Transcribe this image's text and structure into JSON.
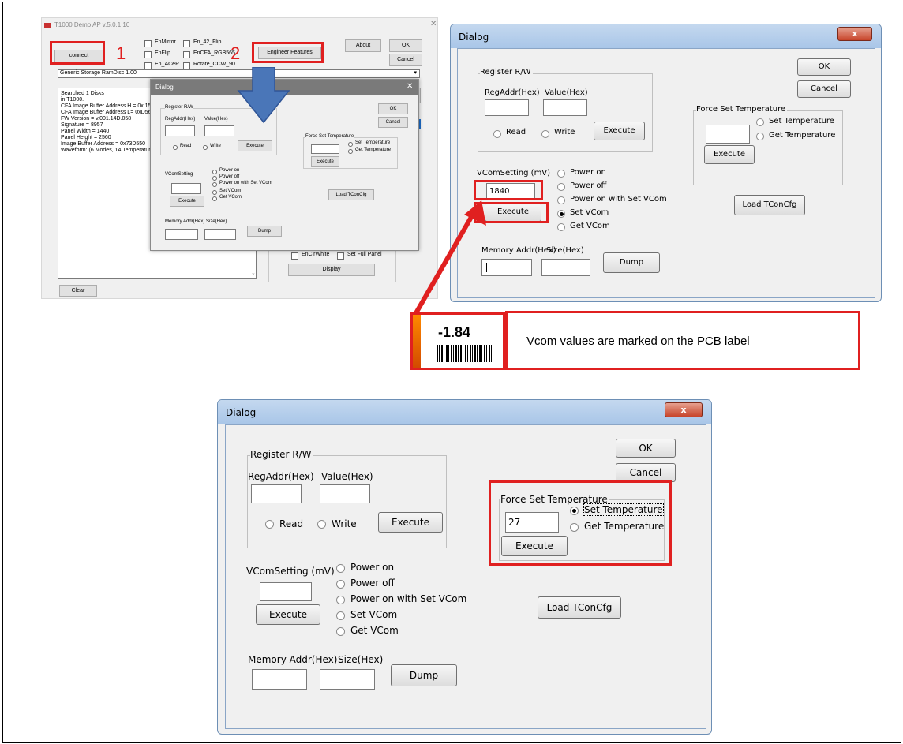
{
  "app": {
    "title": "T1000 Demo AP v.5.0.1.10",
    "connect": "connect",
    "checks": [
      "EnMirror",
      "En_42_Flip",
      "EnFlip",
      "EnCFA_RGB565",
      "En_ACeP",
      "Rotate_CCW_90"
    ],
    "engineer_features": "Engineer Features",
    "about": "About",
    "ok": "OK",
    "cancel": "Cancel",
    "disk_select": "Generic Storage RamDisc 1.00",
    "log_lines": [
      "Searched 1 Disks",
      "in T1000.",
      "CFA Image Buffer Address H = 0x 154",
      "CFA Image Buffer Address L= 0xD568",
      "FW Version = v.001.14D.058",
      "Signature = 8957",
      "Panel Width = 1440",
      "Panel Height = 2560",
      "Image Buffer Address = 0x73D550",
      "Waveform: (6 Modes, 14 Temperature"
    ],
    "clear": "Clear",
    "en_clr_white": "EnClrWhite",
    "set_full_panel": "Set Full Panel",
    "display": "Display"
  },
  "callouts": {
    "step1": "1",
    "step2": "2"
  },
  "dialog": {
    "title": "Dialog",
    "ok": "OK",
    "cancel": "Cancel",
    "register_rw": "Register R/W",
    "reg_addr": "RegAddr(Hex)",
    "value": "Value(Hex)",
    "read": "Read",
    "write": "Write",
    "execute": "Execute",
    "force_set_temp": "Force Set Temperature",
    "set_temp": "Set Temperature",
    "get_temp": "Get Temperature",
    "vcom_setting_short": "VComSetting",
    "vcom_setting": "VComSetting (mV)",
    "power_on": "Power on",
    "power_off": "Power off",
    "power_on_set_vcom": "Power on with Set VCom",
    "set_vcom": "Set VCom",
    "get_vcom": "Get VCom",
    "load_tcon": "Load TConCfg",
    "memory_addr": "Memory Addr(Hex)",
    "size": "Size(Hex)",
    "dump": "Dump",
    "close_glyph": "x"
  },
  "vcom_dialog": {
    "vcom_value": "1840",
    "selected": "set_vcom"
  },
  "temp_dialog": {
    "temp_value": "27",
    "selected": "set_temp"
  },
  "pcb_label": {
    "value": "-1.84",
    "note": "Vcom values are marked on the PCB label"
  },
  "colors": {
    "callout_red": "#e02020",
    "arrow_blue": "#4a76b8",
    "title_bar": "#b9d1ee"
  }
}
